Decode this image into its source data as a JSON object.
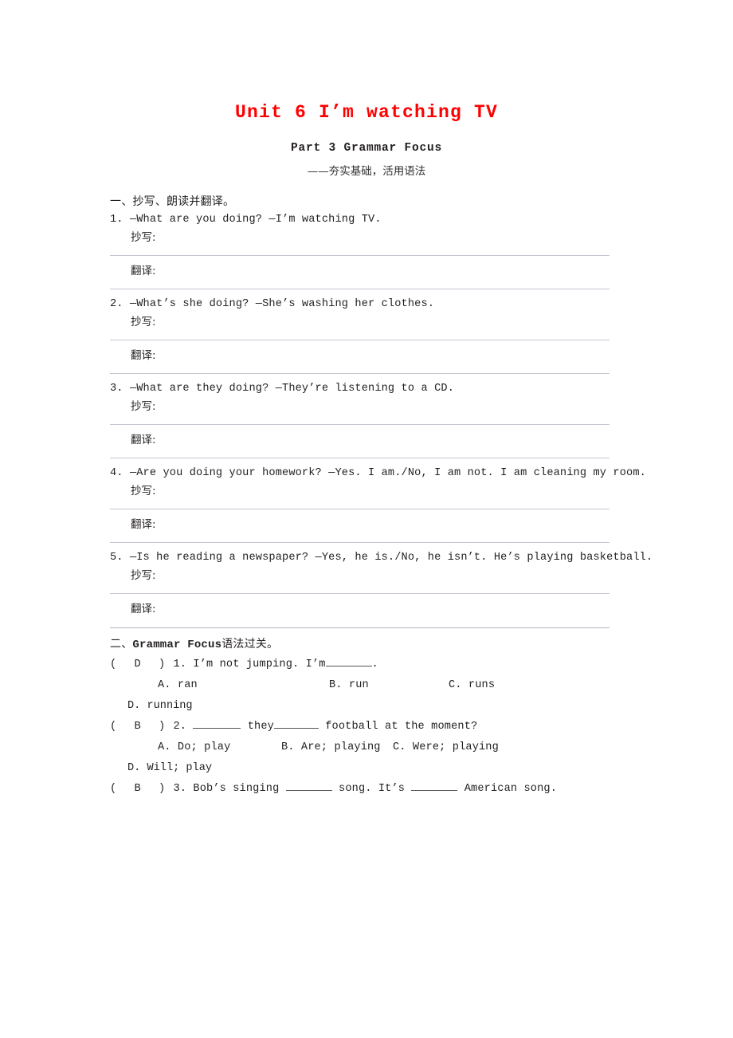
{
  "document": {
    "title": "Unit 6 I’m watching TV",
    "subtitle": "Part 3  Grammar Focus",
    "subtitle_note": "——夯实基础，活用语法"
  },
  "section_one": {
    "heading": "一、抄写、朗读并翻译。",
    "label_copy": "抄写:",
    "label_translate": "翻译:",
    "items": [
      {
        "number": "1.",
        "text": "—What are you doing?  —I’m watching TV."
      },
      {
        "number": "2.",
        "text": "—What’s she doing?  —She’s washing her clothes."
      },
      {
        "number": "3.",
        "text": "—What are they doing?  —They’re listening to a CD."
      },
      {
        "number": "4.",
        "text": "—Are you doing your homework?  —Yes. I am./No, I am not. I am cleaning my room."
      },
      {
        "number": "5.",
        "text": "—Is he reading a newspaper?  —Yes, he is./No, he isn’t. He’s playing basketball."
      }
    ]
  },
  "section_two": {
    "heading_prefix": "二、",
    "heading_mono": "Grammar Focus",
    "heading_suffix": "语法过关。",
    "questions": [
      {
        "answer": "D",
        "number": "1.",
        "stem_before": "I’m not jumping. I’m",
        "stem_after": ".",
        "options_row": [
          "A. ran",
          "B. run",
          "C. runs"
        ],
        "option_last": "D. running"
      },
      {
        "answer": "B",
        "number": "2.",
        "stem_before": "",
        "stem_mid": "they",
        "stem_after": "football at the moment?",
        "options_row": [
          "A. Do; play",
          "B. Are; playing",
          "C. Were; playing"
        ],
        "option_last": "D. Will; play"
      },
      {
        "answer": "B",
        "number": "3.",
        "stem_before": "Bob’s singing",
        "stem_mid": "song. It’s",
        "stem_after": "American song."
      }
    ]
  },
  "colors": {
    "title": "#ff0000",
    "text": "#231f20",
    "rule": "#c9c4d0"
  }
}
